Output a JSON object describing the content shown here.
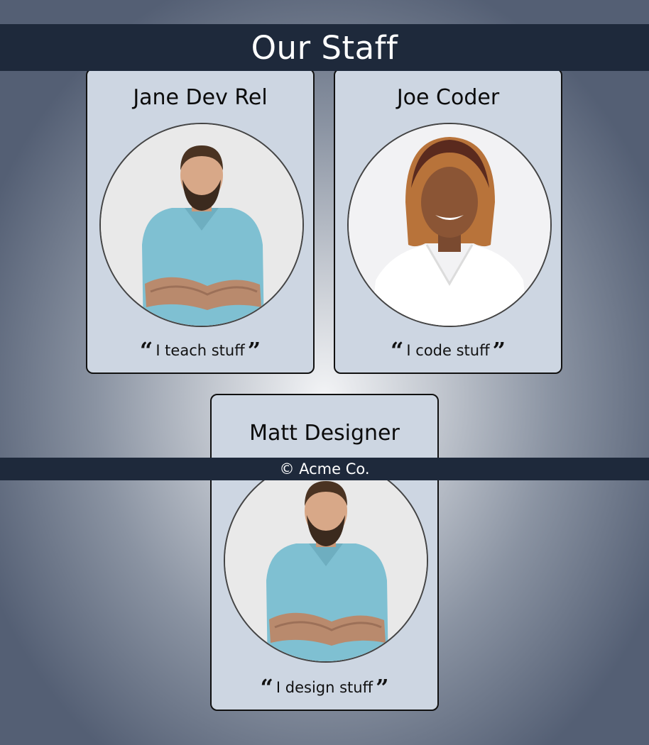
{
  "header": {
    "title": "Our Staff"
  },
  "footer": {
    "copyright": "© Acme Co."
  },
  "quote_marks": {
    "open": "“",
    "close": "”"
  },
  "staff": [
    {
      "name": "Jane Dev Rel",
      "quote": "I teach stuff",
      "photo": "man-in-blue-polo-photo"
    },
    {
      "name": "Joe Coder",
      "quote": "I code stuff",
      "photo": "woman-in-white-blazer-photo"
    },
    {
      "name": "Matt Designer",
      "quote": "I design stuff",
      "photo": "man-in-blue-polo-photo"
    }
  ],
  "colors": {
    "bar": "#1e293b",
    "card": "#cdd6e2",
    "card_border": "#111111"
  }
}
